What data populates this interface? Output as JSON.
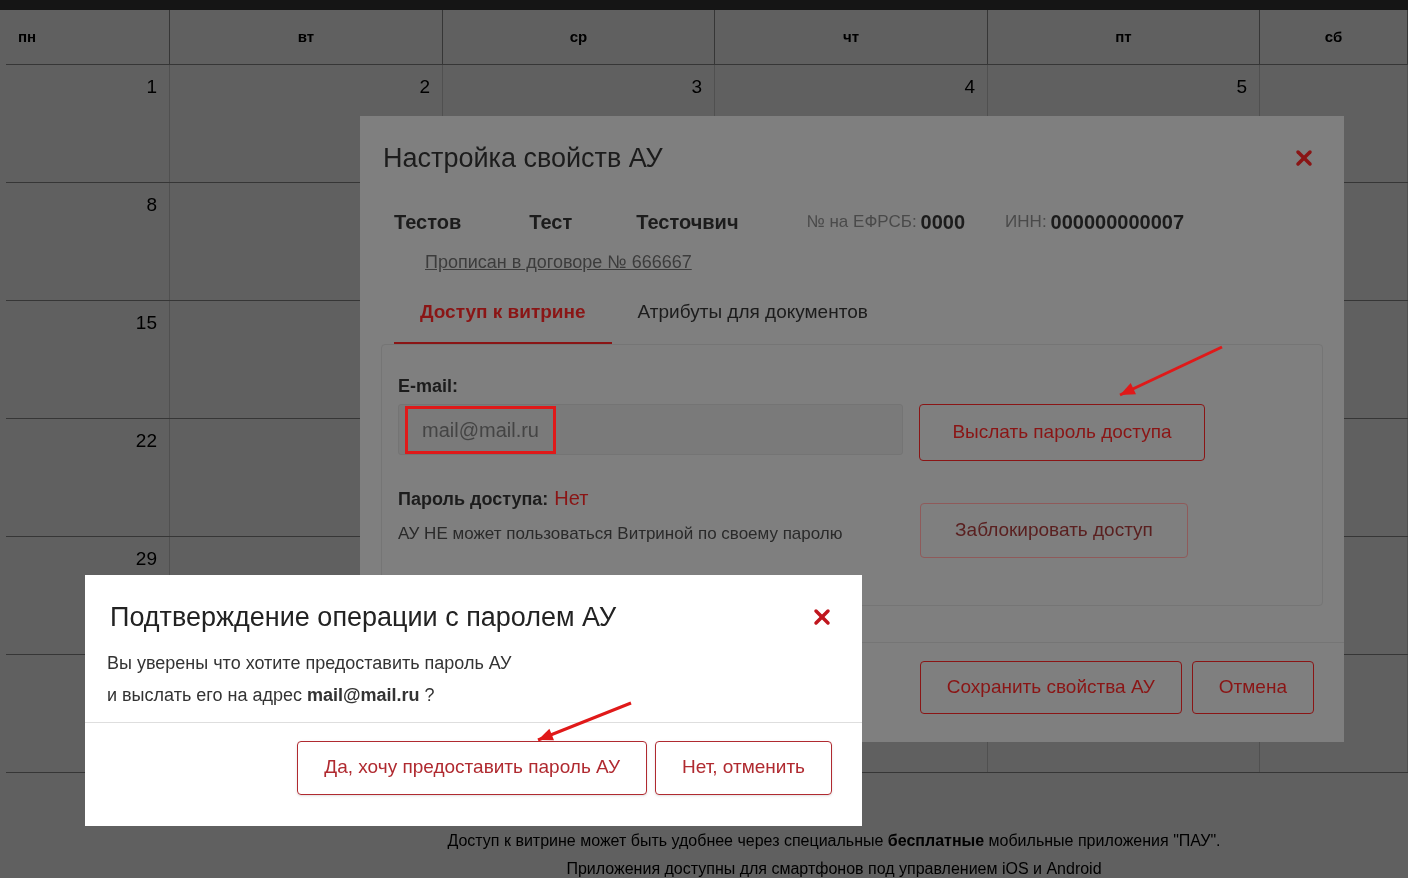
{
  "calendar": {
    "weekdays": [
      "пн",
      "вт",
      "ср",
      "чт",
      "пт",
      "сб"
    ],
    "weeks": [
      {
        "days": [
          "1",
          "2",
          "3",
          "4",
          "5"
        ]
      },
      {
        "days": [
          "8"
        ]
      },
      {
        "days": [
          "15"
        ]
      },
      {
        "days": [
          "22"
        ]
      },
      {
        "days": [
          "29"
        ]
      }
    ]
  },
  "footer_note": [
    "Доступ к витрине может быть удобнее через специальные **бесплатные** мобильные приложения \"ПАУ\".",
    "Приложения доступны для смартфонов под управлением iOS и Android"
  ],
  "settings_dialog": {
    "title": "Настройка свойств АУ",
    "person": [
      "Тестов",
      "Тест",
      "Тесточвич"
    ],
    "efrsb": {
      "label": "№ на ЕФРСБ:",
      "value": "0000"
    },
    "inn": {
      "label": "ИНН:",
      "value": "000000000007"
    },
    "contract_link": "Прописан в договоре № 666667",
    "tabs": [
      {
        "label": "Доступ к витрине",
        "selected": true
      },
      {
        "label": "Атрибуты для документов",
        "selected": false
      }
    ],
    "email": {
      "label": "E-mail:",
      "value": "mail@mail.ru"
    },
    "send_button": "Выслать пароль доступа",
    "password": {
      "label": "Пароль доступа:",
      "value": "Нет"
    },
    "password_note": "АУ НЕ может пользоваться Витриной по своему паролю",
    "block_button": {
      "label": "Заблокировать доступ",
      "disabled": true
    },
    "buttons": [
      "Сохранить свойства АУ",
      "Отмена"
    ]
  },
  "confirm_dialog": {
    "title": "Подтверждение операции с паролем АУ",
    "message": [
      "Вы уверены что хотите предоставить пароль АУ",
      "и выслать его на адрес **mail@mail.ru** ?"
    ],
    "buttons": [
      "Да, хочу предоставить пароль АУ",
      "Нет, отменить"
    ]
  }
}
